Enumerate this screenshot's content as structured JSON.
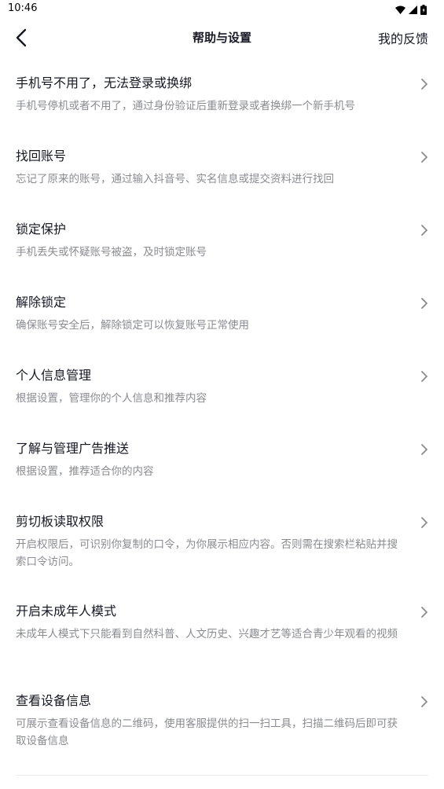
{
  "status": {
    "time": "10:46"
  },
  "header": {
    "title": "帮助与设置",
    "feedback_label": "我的反馈"
  },
  "items": [
    {
      "title": "手机号不用了，无法登录或换绑",
      "desc": "手机号停机或者不用了，通过身份验证后重新登录或者换绑一个新手机号"
    },
    {
      "title": "找回账号",
      "desc": "忘记了原来的账号，通过输入抖音号、实名信息或提交资料进行找回"
    },
    {
      "title": "锁定保护",
      "desc": "手机丢失或怀疑账号被盗，及时锁定账号"
    },
    {
      "title": "解除锁定",
      "desc": "确保账号安全后，解除锁定可以恢复账号正常使用"
    },
    {
      "title": "个人信息管理",
      "desc": "根据设置，管理你的个人信息和推荐内容"
    },
    {
      "title": "了解与管理广告推送",
      "desc": "根据设置，推荐适合你的内容"
    },
    {
      "title": "剪切板读取权限",
      "desc": "开启权限后，可识别你复制的口令，为你展示相应内容。否则需在搜索栏粘贴并搜索口令访问。"
    },
    {
      "title": "开启未成年人模式",
      "desc": "未成年人模式下只能看到自然科普、人文历史、兴趣才艺等适合青少年观看的视频"
    },
    {
      "title": "查看设备信息",
      "desc": "可展示查看设备信息的二维码，使用客服提供的扫一扫工具，扫描二维码后即可获取设备信息"
    }
  ],
  "icons": {
    "back": "chevron-left-icon",
    "item_arrow": "chevron-right-icon",
    "wifi": "wifi-icon",
    "signal": "signal-icon",
    "battery": "battery-icon"
  },
  "colors": {
    "text_primary": "#161823",
    "text_secondary": "#8a8b91",
    "background": "#ffffff"
  }
}
